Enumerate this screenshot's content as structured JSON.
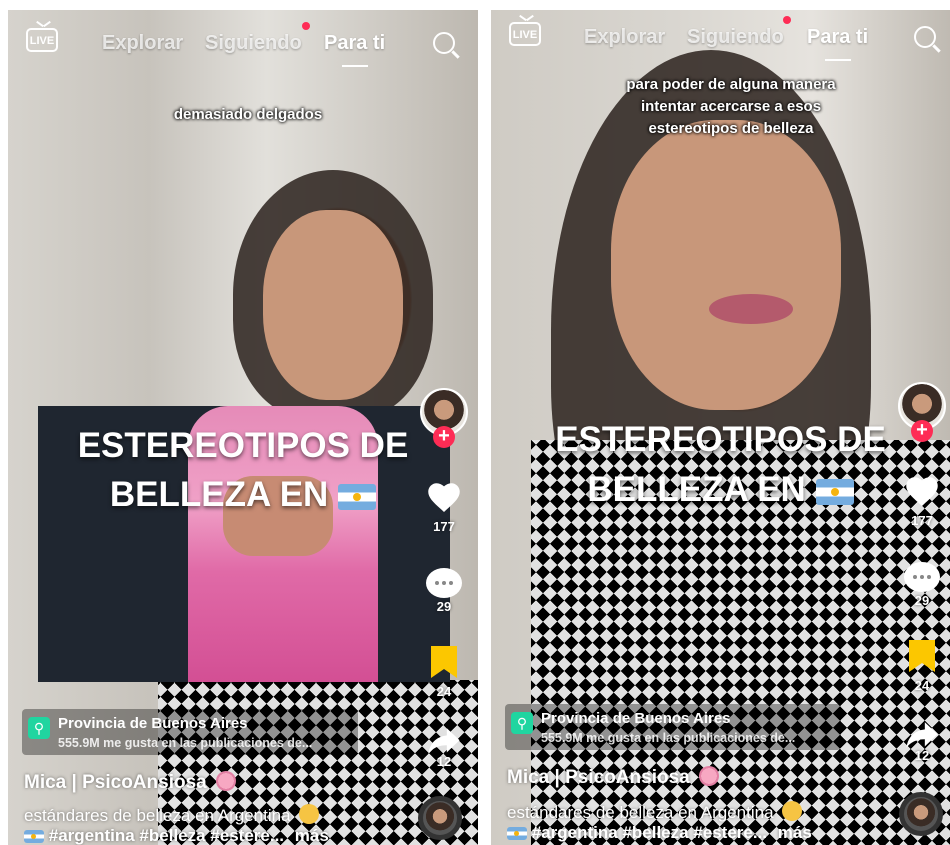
{
  "nav": {
    "live_label": "LIVE",
    "tabs": [
      "Explorar",
      "Siguiendo",
      "Para ti"
    ],
    "active_tab": "Para ti"
  },
  "colors": {
    "accent": "#fe2c55",
    "bookmark": "#fcc700",
    "location_pin": "#20d5a0"
  },
  "panels": [
    {
      "caption": "demasiado delgados",
      "overlay_title_line1": "ESTEREOTIPOS DE",
      "overlay_title_line2": "BELLEZA EN",
      "likes": "177",
      "comments": "29",
      "saves": "24",
      "shares": "12",
      "location_title": "Provincia de Buenos Aires",
      "location_sub": "555.9M me gusta en las publicaciones de...",
      "author": "Mica | PsicoAnsiosa",
      "description": "estándares de belleza en Argentina",
      "hashtags": "#argentina #belleza #estere...",
      "more": "más"
    },
    {
      "caption_lines": [
        "para poder de alguna manera",
        "intentar acercarse a esos",
        "estereotipos de belleza"
      ],
      "overlay_title_line1": "ESTEREOTIPOS DE",
      "overlay_title_line2": "BELLEZA EN",
      "likes": "177",
      "comments": "29",
      "saves": "24",
      "shares": "12",
      "location_title": "Provincia de Buenos Aires",
      "location_sub": "555.9M me gusta en las publicaciones de...",
      "author": "Mica | PsicoAnsiosa",
      "description": "estándares de belleza en Argentina",
      "hashtags": "#argentina #belleza #estere...",
      "more": "más"
    }
  ]
}
